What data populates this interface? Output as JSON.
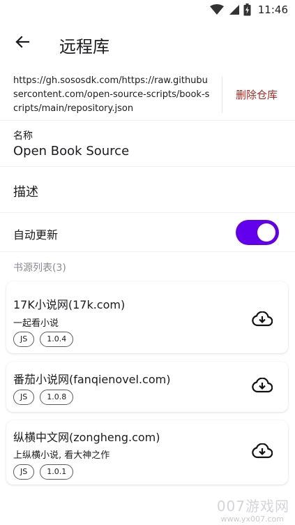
{
  "status_bar": {
    "time": "11:46"
  },
  "app_bar": {
    "title": "远程库"
  },
  "repository": {
    "url": "https://gh.sososdk.com/https://raw.githubusercontent.com/open-source-scripts/book-scripts/main/repository.json",
    "delete_label": "删除仓库"
  },
  "name": {
    "label": "名称",
    "value": "Open Book Source"
  },
  "description": {
    "label": "描述"
  },
  "auto_update": {
    "label": "自动更新",
    "enabled": true
  },
  "sources": {
    "header": "书源列表(3)",
    "items": [
      {
        "title": "17K小说网(17k.com)",
        "desc": "一起看小说",
        "tags": [
          "JS",
          "1.0.4"
        ]
      },
      {
        "title": "番茄小说网(fanqienovel.com)",
        "desc": "",
        "tags": [
          "JS",
          "1.0.8"
        ]
      },
      {
        "title": "纵横中文网(zongheng.com)",
        "desc": "上纵横小说, 看大神之作",
        "tags": [
          "JS",
          "1.0.1"
        ]
      }
    ]
  },
  "watermark": {
    "text": "007游戏网",
    "url": "www.yx007.com"
  },
  "colors": {
    "accent": "#6200ee",
    "danger": "#b3261e"
  }
}
